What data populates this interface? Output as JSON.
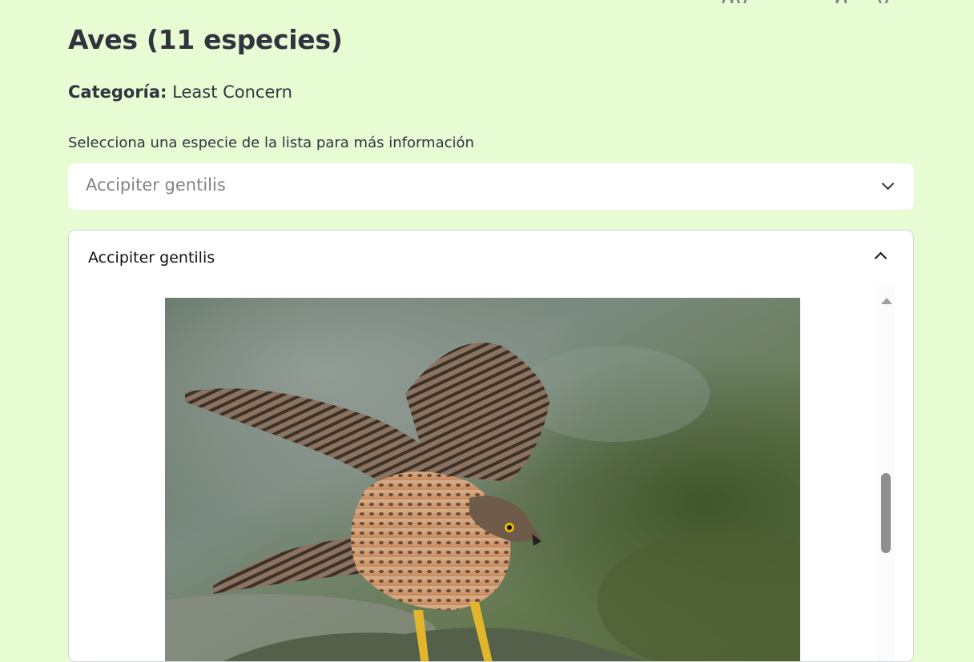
{
  "page": {
    "title": "Aves (11 especies)",
    "category_label": "Categoría:",
    "category_value": "Least Concern"
  },
  "species_select": {
    "label": "Selecciona una especie de la lista para más información",
    "value": "Accipiter gentilis",
    "icon": "chevron-down-icon"
  },
  "expander": {
    "title": "Accipiter gentilis",
    "icon": "chevron-up-icon",
    "expanded": true
  },
  "colors": {
    "background": "#e8fcd4",
    "card": "#ffffff",
    "text": "#31333f"
  }
}
